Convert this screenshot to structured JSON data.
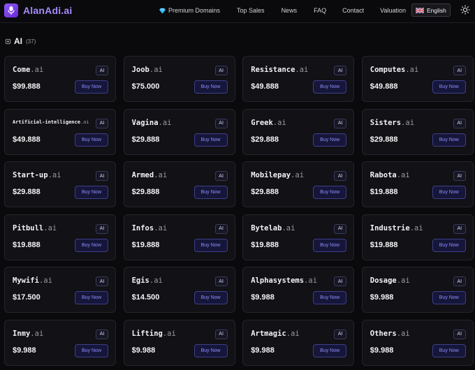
{
  "header": {
    "brand": "AlanAdi.ai",
    "nav": [
      {
        "label": "Premium Domains",
        "icon": "gem-icon"
      },
      {
        "label": "Top Sales"
      },
      {
        "label": "News"
      },
      {
        "label": "FAQ"
      },
      {
        "label": "Contact"
      },
      {
        "label": "Valuation"
      }
    ],
    "language": "English",
    "theme_icon": "sun-icon"
  },
  "section": {
    "title": "AI",
    "count": "(37)"
  },
  "colors": {
    "accent": "#8b5cf6",
    "brand_text": "#a78bfa",
    "button_text": "#8e8efb",
    "background": "#0a0a0d",
    "card": "#111116"
  },
  "cards": [
    {
      "name": "Come",
      "tld": ".ai",
      "badge": "AI",
      "price": "$99.888",
      "button": "Buy Now"
    },
    {
      "name": "Joob",
      "tld": ".ai",
      "badge": "AI",
      "price": "$75.000",
      "button": "Buy Now"
    },
    {
      "name": "Resistance",
      "tld": ".ai",
      "badge": "AI",
      "price": "$49.888",
      "button": "Buy Now"
    },
    {
      "name": "Computes",
      "tld": ".ai",
      "badge": "AI",
      "price": "$49.888",
      "button": "Buy Now"
    },
    {
      "name": "Artificial-intelligence",
      "tld": ".ai",
      "badge": "AI",
      "price": "$49.888",
      "button": "Buy Now"
    },
    {
      "name": "Vagina",
      "tld": ".ai",
      "badge": "AI",
      "price": "$29.888",
      "button": "Buy Now"
    },
    {
      "name": "Greek",
      "tld": ".ai",
      "badge": "AI",
      "price": "$29.888",
      "button": "Buy Now"
    },
    {
      "name": "Sisters",
      "tld": ".ai",
      "badge": "AI",
      "price": "$29.888",
      "button": "Buy Now"
    },
    {
      "name": "Start-up",
      "tld": ".ai",
      "badge": "AI",
      "price": "$29.888",
      "button": "Buy Now"
    },
    {
      "name": "Armed",
      "tld": ".ai",
      "badge": "AI",
      "price": "$29.888",
      "button": "Buy Now"
    },
    {
      "name": "Mobilepay",
      "tld": ".ai",
      "badge": "AI",
      "price": "$29.888",
      "button": "Buy Now"
    },
    {
      "name": "Rabota",
      "tld": ".ai",
      "badge": "AI",
      "price": "$19.888",
      "button": "Buy Now"
    },
    {
      "name": "Pitbull",
      "tld": ".ai",
      "badge": "AI",
      "price": "$19.888",
      "button": "Buy Now"
    },
    {
      "name": "Infos",
      "tld": ".ai",
      "badge": "AI",
      "price": "$19.888",
      "button": "Buy Now"
    },
    {
      "name": "Bytelab",
      "tld": ".ai",
      "badge": "AI",
      "price": "$19.888",
      "button": "Buy Now"
    },
    {
      "name": "Industrie",
      "tld": ".ai",
      "badge": "AI",
      "price": "$19.888",
      "button": "Buy Now"
    },
    {
      "name": "Mywifi",
      "tld": ".ai",
      "badge": "AI",
      "price": "$17.500",
      "button": "Buy Now"
    },
    {
      "name": "Egis",
      "tld": ".ai",
      "badge": "AI",
      "price": "$14.500",
      "button": "Buy Now"
    },
    {
      "name": "Alphasystems",
      "tld": ".ai",
      "badge": "AI",
      "price": "$9.988",
      "button": "Buy Now"
    },
    {
      "name": "Dosage",
      "tld": ".ai",
      "badge": "AI",
      "price": "$9.988",
      "button": "Buy Now"
    },
    {
      "name": "Inmy",
      "tld": ".ai",
      "badge": "AI",
      "price": "$9.988",
      "button": "Buy Now"
    },
    {
      "name": "Lifting",
      "tld": ".ai",
      "badge": "AI",
      "price": "$9.988",
      "button": "Buy Now"
    },
    {
      "name": "Artmagic",
      "tld": ".ai",
      "badge": "AI",
      "price": "$9.988",
      "button": "Buy Now"
    },
    {
      "name": "Others",
      "tld": ".ai",
      "badge": "AI",
      "price": "$9.988",
      "button": "Buy Now"
    }
  ]
}
